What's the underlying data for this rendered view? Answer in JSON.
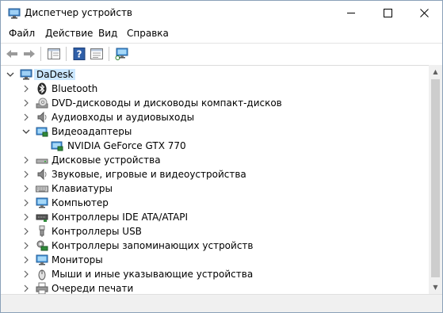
{
  "window": {
    "title": "Диспетчер устройств"
  },
  "menu": {
    "items": [
      {
        "label": "Файл"
      },
      {
        "label": "Действие"
      },
      {
        "label": "Вид"
      },
      {
        "label": "Справка"
      }
    ]
  },
  "tree": {
    "root": {
      "label": "DaDesk",
      "icon": "computer-icon"
    },
    "items": [
      {
        "label": "Bluetooth",
        "icon": "bluetooth-icon",
        "expanded": false
      },
      {
        "label": "DVD-дисководы и дисководы компакт-дисков",
        "icon": "dvd-icon",
        "expanded": false
      },
      {
        "label": "Аудиовходы и аудиовыходы",
        "icon": "speaker-icon",
        "expanded": false
      },
      {
        "label": "Видеоадаптеры",
        "icon": "display-adapter-icon",
        "expanded": true,
        "children": [
          {
            "label": "NVIDIA GeForce GTX 770",
            "icon": "display-adapter-icon"
          }
        ]
      },
      {
        "label": "Дисковые устройства",
        "icon": "disk-icon",
        "expanded": false
      },
      {
        "label": "Звуковые, игровые и видеоустройства",
        "icon": "speaker-icon",
        "expanded": false
      },
      {
        "label": "Клавиатуры",
        "icon": "keyboard-icon",
        "expanded": false
      },
      {
        "label": "Компьютер",
        "icon": "monitor-icon",
        "expanded": false
      },
      {
        "label": "Контроллеры IDE ATA/ATAPI",
        "icon": "ide-icon",
        "expanded": false
      },
      {
        "label": "Контроллеры USB",
        "icon": "usb-icon",
        "expanded": false
      },
      {
        "label": "Контроллеры запоминающих устройств",
        "icon": "storage-icon",
        "expanded": false
      },
      {
        "label": "Мониторы",
        "icon": "monitor-icon",
        "expanded": false
      },
      {
        "label": "Мыши и иные указывающие устройства",
        "icon": "mouse-icon",
        "expanded": false
      },
      {
        "label": "Очереди печати",
        "icon": "printer-icon",
        "expanded": false
      }
    ]
  },
  "colors": {
    "selection": "#cce8ff",
    "accent": "#2a6fb8"
  }
}
